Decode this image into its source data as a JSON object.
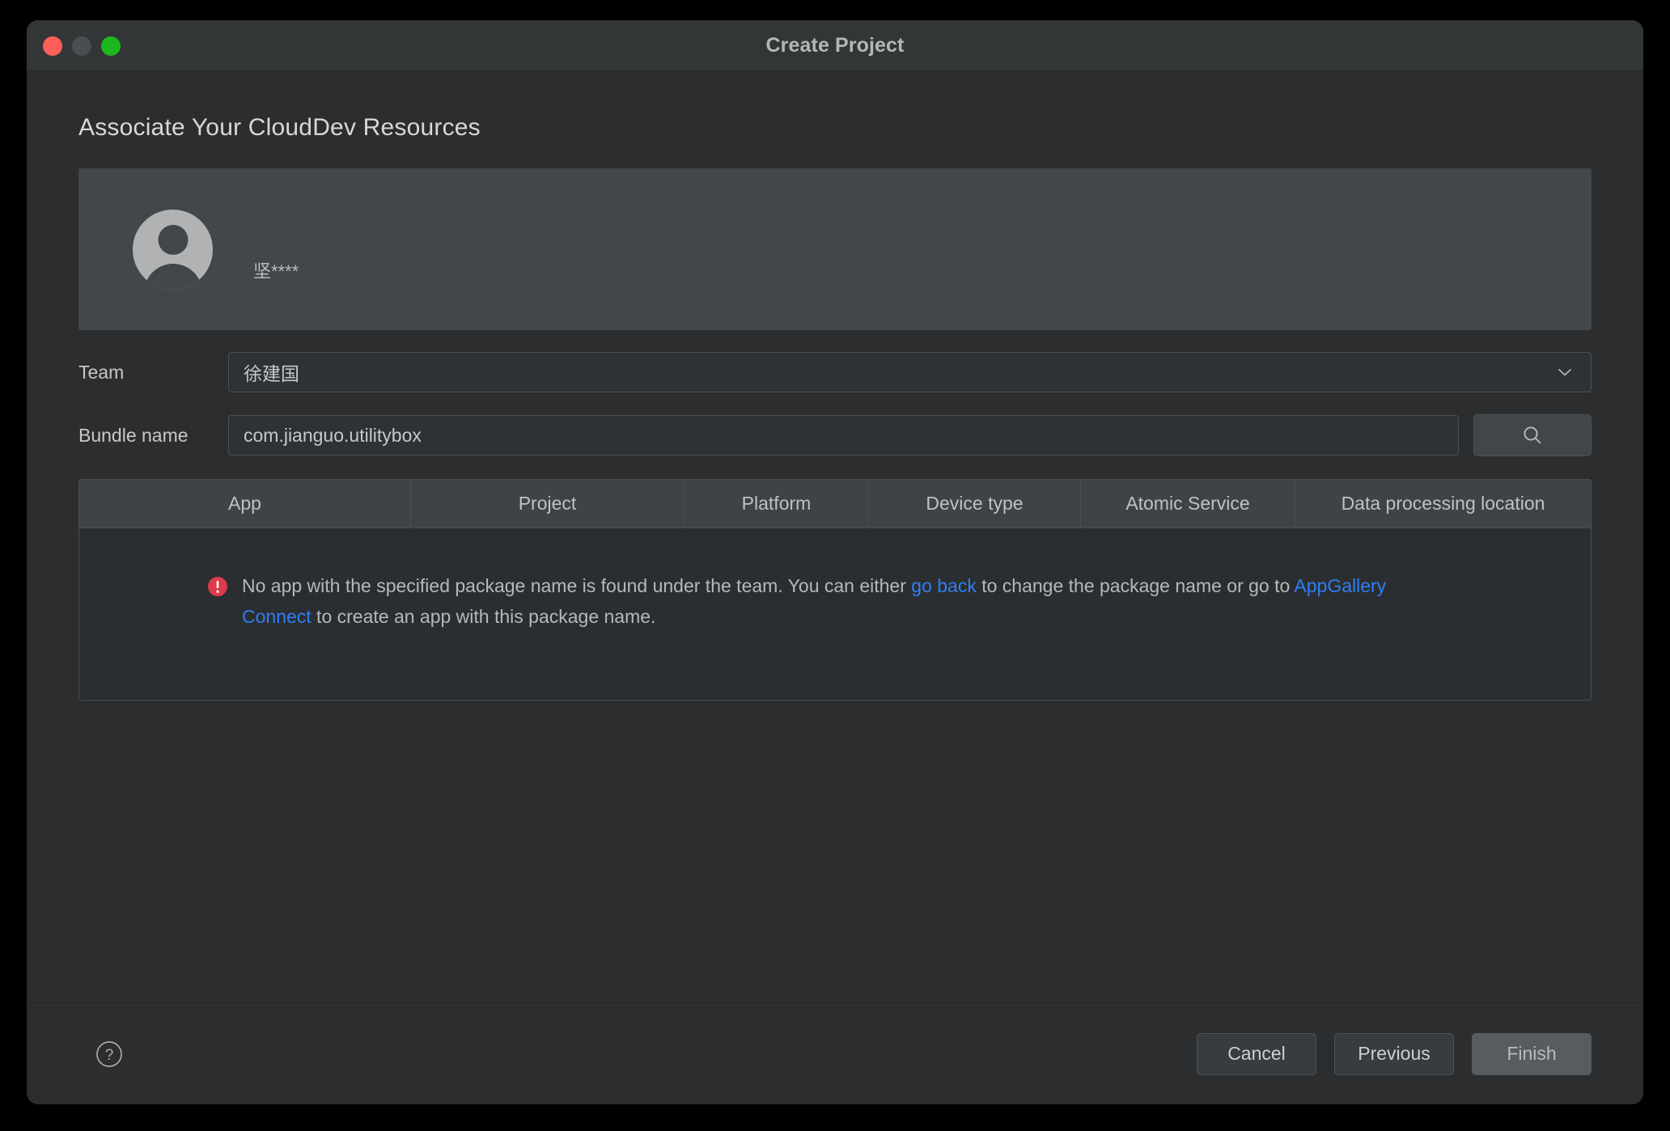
{
  "window": {
    "title": "Create Project",
    "traffic_lights": [
      "close",
      "minimize",
      "zoom"
    ]
  },
  "page": {
    "title": "Associate Your CloudDev Resources"
  },
  "account": {
    "name": "坚****",
    "avatar_icon": "user-avatar-icon"
  },
  "form": {
    "team": {
      "label": "Team",
      "value": "徐建国",
      "chevron_icon": "chevron-down-icon"
    },
    "bundle": {
      "label": "Bundle name",
      "value": "com.jianguo.utilitybox",
      "placeholder": "com.example.app"
    },
    "search_button": {
      "icon": "search-icon"
    }
  },
  "table": {
    "columns": [
      "App",
      "Project",
      "Platform",
      "Device type",
      "Atomic Service",
      "Data processing location"
    ],
    "rows": [],
    "empty_state": {
      "icon": "error-icon",
      "segments": [
        {
          "type": "text",
          "value": "No app with the specified package name is found under the team. You can either "
        },
        {
          "type": "link",
          "value": "go back"
        },
        {
          "type": "text",
          "value": " to change the package name or go to "
        },
        {
          "type": "link",
          "value": "AppGallery Connect"
        },
        {
          "type": "text",
          "value": " to create an app with this package name."
        }
      ]
    }
  },
  "footer": {
    "help_icon": "help-icon",
    "cancel_label": "Cancel",
    "previous_label": "Previous",
    "finish_label": "Finish"
  },
  "colors": {
    "window_bg": "#2b2d2f",
    "titlebar_bg": "#333637",
    "card_bg": "#434749",
    "table_header_bg": "#3f4345",
    "table_body_bg": "#2b2e30",
    "link": "#2f7ef5",
    "error": "#dc3b4c",
    "close_light": "#ff5f57",
    "min_light": "#4b4e50",
    "zoom_light": "#1db81d"
  }
}
